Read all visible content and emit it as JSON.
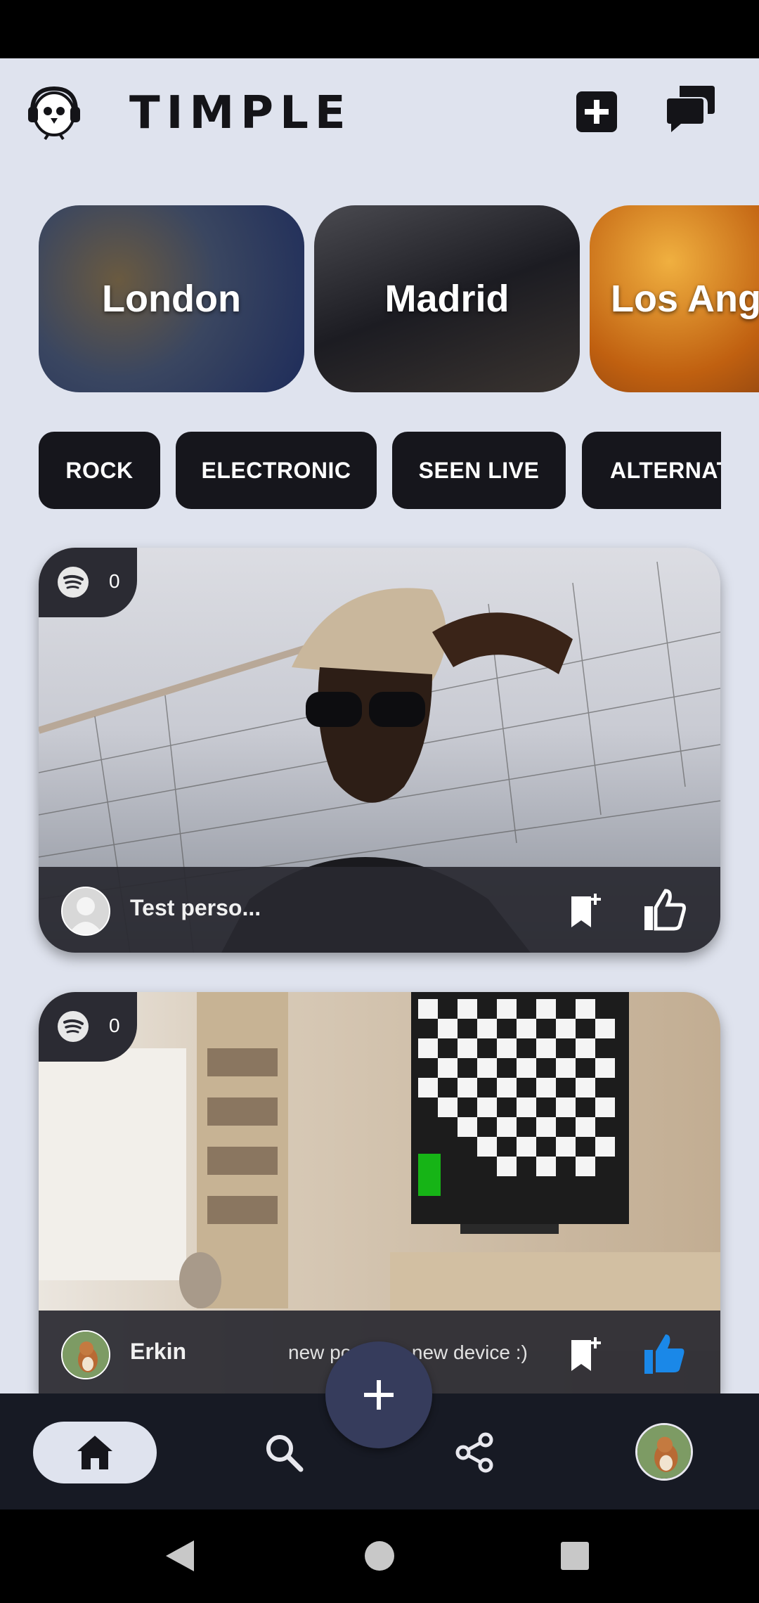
{
  "app": {
    "title": "TIMPLE"
  },
  "header": {
    "add_icon": "plus-square-icon",
    "chat_icon": "chat-bubbles-icon",
    "logo_icon": "bird-headphones-logo"
  },
  "cities": [
    {
      "label": "London"
    },
    {
      "label": "Madrid"
    },
    {
      "label": "Los Ang"
    }
  ],
  "genres": [
    {
      "label": "ROCK"
    },
    {
      "label": "ELECTRONIC"
    },
    {
      "label": "SEEN LIVE"
    },
    {
      "label": "ALTERNAT"
    }
  ],
  "posts": [
    {
      "spotify_count": "0",
      "username": "Test perso...",
      "caption": "",
      "liked": false
    },
    {
      "spotify_count": "0",
      "username": "Erkin",
      "caption": "new po        a new device :)",
      "liked": true
    }
  ],
  "nav": {
    "home_icon": "home-icon",
    "search_icon": "search-icon",
    "share_icon": "share-icon",
    "fab_icon": "plus-icon"
  },
  "colors": {
    "accent_like": "#1a88e8",
    "dark": "#16161c",
    "background": "#dfe3ee",
    "fab": "#363c5c"
  }
}
